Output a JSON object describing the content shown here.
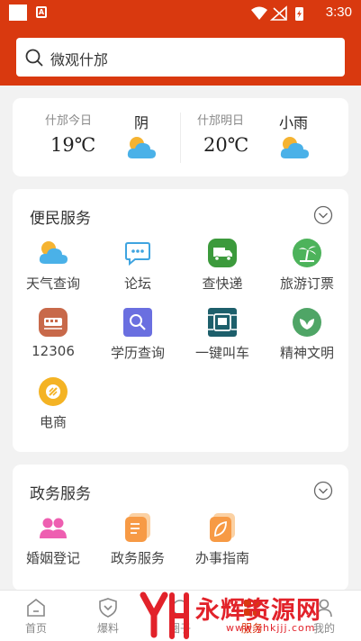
{
  "status_bar": {
    "time": "3:30",
    "notification_icon_letter": "A"
  },
  "search": {
    "placeholder": "微观什邡"
  },
  "weather": {
    "today": {
      "label": "什邡今日",
      "temp": "19℃",
      "condition": "阴"
    },
    "tomorrow": {
      "label": "什邡明日",
      "temp": "20℃",
      "condition": "小雨"
    }
  },
  "services": {
    "title": "便民服务",
    "items": [
      {
        "label": "天气查询",
        "icon": "weather-cloud-icon"
      },
      {
        "label": "论坛",
        "icon": "forum-chat-icon"
      },
      {
        "label": "查快递",
        "icon": "express-truck-icon"
      },
      {
        "label": "旅游订票",
        "icon": "travel-palm-icon"
      },
      {
        "label": "12306",
        "icon": "train-ticket-icon"
      },
      {
        "label": "学历查询",
        "icon": "education-search-icon"
      },
      {
        "label": "一键叫车",
        "icon": "taxi-call-icon"
      },
      {
        "label": "精神文明",
        "icon": "civilization-leaf-icon"
      },
      {
        "label": "电商",
        "icon": "ecommerce-coin-icon"
      }
    ]
  },
  "gov": {
    "title": "政务服务",
    "items": [
      {
        "label": "婚姻登记",
        "icon": "marriage-people-icon"
      },
      {
        "label": "政务服务",
        "icon": "gov-doc-icon"
      },
      {
        "label": "办事指南",
        "icon": "guide-leaf-icon"
      }
    ]
  },
  "tabbar": {
    "tabs": [
      {
        "label": "首页",
        "icon": "home-icon"
      },
      {
        "label": "爆料",
        "icon": "shield-icon"
      },
      {
        "label": "圈子",
        "icon": "circle-icon"
      },
      {
        "label": "服务",
        "icon": "service-icon"
      },
      {
        "label": "我的",
        "icon": "user-icon"
      }
    ]
  },
  "watermark": {
    "brand": "永辉资源网",
    "url": "www.yhkjjj.com"
  },
  "colors": {
    "accent": "#d9390f",
    "page_bg": "#f2f2f2",
    "card_bg": "#ffffff"
  }
}
